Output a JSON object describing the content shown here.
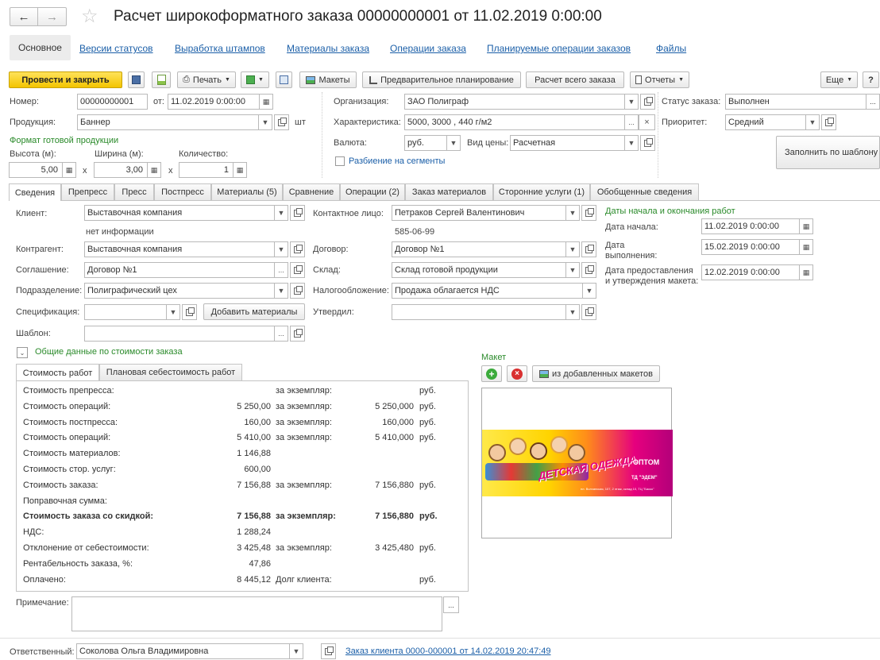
{
  "window": {
    "title": "Расчет широкоформатного заказа 00000000001 от 11.02.2019 0:00:00"
  },
  "topnav": {
    "items": [
      "Основное",
      "Версии статусов",
      "Выработка штампов",
      "Материалы заказа",
      "Операции заказа",
      "Планируемые операции заказов",
      "Файлы"
    ]
  },
  "toolbar": {
    "post_close": "Провести и закрыть",
    "print": "Печать",
    "layouts": "Макеты",
    "preplanning": "Предварительное планирование",
    "calc_all": "Расчет всего заказа",
    "reports": "Отчеты",
    "more": "Еще",
    "help": "?"
  },
  "header": {
    "number_label": "Номер:",
    "number": "00000000001",
    "from_label": "от:",
    "date": "11.02.2019  0:00:00",
    "product_label": "Продукция:",
    "product": "Баннер",
    "unit": "шт",
    "format_title": "Формат готовой продукции",
    "height_label": "Высота (м):",
    "height": "5,00",
    "width_label": "Ширина (м):",
    "width": "3,00",
    "qty_label": "Количество:",
    "qty": "1",
    "x": "x",
    "org_label": "Организация:",
    "org": "ЗАО Полиграф",
    "char_label": "Характеристика:",
    "char": "5000, 3000 , 440 г/м2",
    "currency_label": "Валюта:",
    "currency": "руб.",
    "price_type_label": "Вид цены:",
    "price_type": "Расчетная",
    "segments": "Разбиение на сегменты",
    "status_label": "Статус заказа:",
    "status": "Выполнен",
    "priority_label": "Приоритет:",
    "priority": "Средний",
    "fill_template": "Заполнить по шаблону"
  },
  "tabs": [
    "Сведения",
    "Препресс",
    "Пресс",
    "Постпресс",
    "Материалы (5)",
    "Сравнение",
    "Операции (2)",
    "Заказ материалов",
    "Сторонние услуги (1)",
    "Обобщенные сведения"
  ],
  "details": {
    "client_label": "Клиент:",
    "client": "Выставочная компания",
    "no_info": "нет информации",
    "counterparty_label": "Контрагент:",
    "counterparty": "Выставочная компания",
    "agreement_label": "Соглашение:",
    "agreement": "Договор №1",
    "division_label": "Подразделение:",
    "division": "Полиграфический цех",
    "spec_label": "Спецификация:",
    "spec": "",
    "add_materials": "Добавить материалы",
    "template_label": "Шаблон:",
    "template": "",
    "contact_label": "Контактное лицо:",
    "contact": "Петраков Сергей  Валентинович",
    "phone": "585-06-99",
    "contract_label": "Договор:",
    "contract": "Договор №1",
    "warehouse_label": "Склад:",
    "warehouse": "Склад готовой продукции",
    "tax_label": "Налогообложение:",
    "tax": "Продажа облагается НДС",
    "approved_label": "Утвердил:",
    "approved": "",
    "dates_title": "Даты начала и окончания работ",
    "start_label": "Дата начала:",
    "start": "11.02.2019  0:00:00",
    "done_label1": "Дата",
    "done_label2": "выполнения:",
    "done": "15.02.2019  0:00:00",
    "layout_label1": "Дата предоставления",
    "layout_label2": "и утверждения макета:",
    "layout_date": "12.02.2019  0:00:00",
    "cost_group": "Общие данные по стоимости заказа",
    "maket_label": "Макет",
    "from_added": "из добавленных макетов"
  },
  "cost_tabs": [
    "Стоимость работ",
    "Плановая себестоимость работ"
  ],
  "cost_rows": [
    {
      "label": "Стоимость препресса:",
      "value": "",
      "per_label": "за экземпляр:",
      "per": "",
      "cur": "руб."
    },
    {
      "label": "Стоимость операций:",
      "value": "5 250,00",
      "per_label": "за экземпляр:",
      "per": "5 250,000",
      "cur": "руб."
    },
    {
      "label": "Стоимость постпресса:",
      "value": "160,00",
      "per_label": "за экземпляр:",
      "per": "160,000",
      "cur": "руб."
    },
    {
      "label": "Стоимость операций:",
      "value": "5 410,00",
      "per_label": "за экземпляр:",
      "per": "5 410,000",
      "cur": "руб."
    },
    {
      "label": "Стоимость материалов:",
      "value": "1 146,88",
      "per_label": "",
      "per": "",
      "cur": ""
    },
    {
      "label": "Стоимость стор. услуг:",
      "value": "600,00",
      "per_label": "",
      "per": "",
      "cur": ""
    },
    {
      "label": "Стоимость заказа:",
      "value": "7 156,88",
      "per_label": "за экземпляр:",
      "per": "7 156,880",
      "cur": "руб."
    },
    {
      "label": "Поправочная сумма:",
      "value": "",
      "per_label": "",
      "per": "",
      "cur": ""
    },
    {
      "label": "Стоимость заказа со скидкой:",
      "value": "7 156,88",
      "per_label": "за экземпляр:",
      "per": "7 156,880",
      "cur": "руб."
    },
    {
      "label": "НДС:",
      "value": "1 288,24",
      "per_label": "",
      "per": "",
      "cur": ""
    },
    {
      "label": "Отклонение от себестоимости:",
      "value": "3 425,48",
      "per_label": "за экземпляр:",
      "per": "3 425,480",
      "cur": "руб."
    },
    {
      "label": "Рентабельность заказа, %:",
      "value": "47,86",
      "per_label": "",
      "per": "",
      "cur": ""
    },
    {
      "label": "Оплачено:",
      "value": "8 445,12",
      "per_label": "Долг клиента:",
      "per": "",
      "cur": "руб."
    }
  ],
  "note_label": "Примечание:",
  "footer": {
    "responsible_label": "Ответственный:",
    "responsible": "Соколова Ольга Владимировна",
    "client_order_link": "Заказ клиента 0000-000001 от 14.02.2019 20:47:49"
  },
  "banner": {
    "text1": "ДЕТСКАЯ ОДЕЖДА",
    "text2": "ОПТОМ",
    "brand": "ТД \"ЭДЕМ\"",
    "address": "пл. Волчанская, 107, 2 этаж, склад 10, ТЦ \"Баско\""
  },
  "colors": {
    "accent_yellow": "#f3c400",
    "link_blue": "#1b5fa8",
    "green_label": "#2a8a2a"
  }
}
